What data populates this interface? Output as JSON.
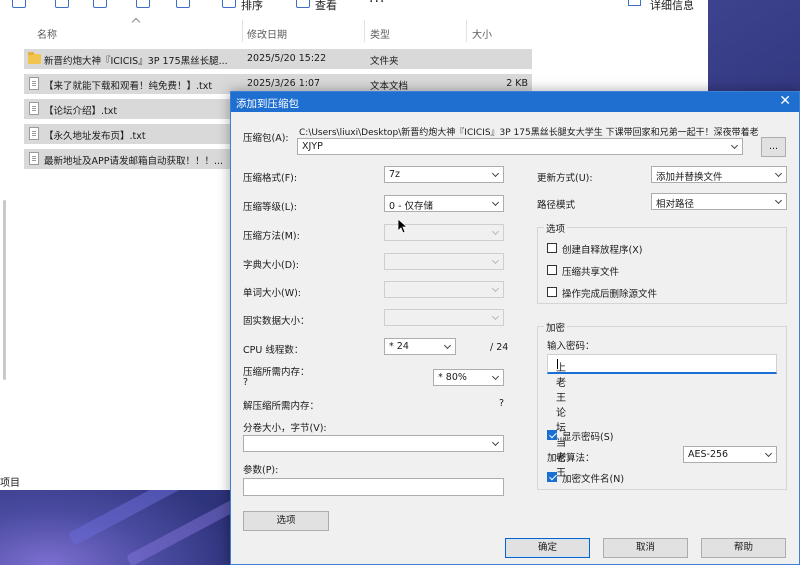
{
  "explorer": {
    "toolbar": {
      "sort_label": "排序",
      "view_label": "查看",
      "more_label": "···",
      "details_label": "详细信息"
    },
    "columns": {
      "name": "名称",
      "modified": "修改日期",
      "type": "类型",
      "size": "大小"
    },
    "rows": [
      {
        "name": "新晋约炮大神『ICICIS』3P 175黑丝长腿...",
        "date": "2025/5/20 15:22",
        "type": "文件夹",
        "size": "",
        "icon": "folder-icon"
      },
      {
        "name": "【来了就能下载和观看！纯免费！】.txt",
        "date": "2025/3/26 1:07",
        "type": "文本文档",
        "size": "2 KB",
        "icon": "text-file-icon"
      },
      {
        "name": "【论坛介绍】.txt",
        "date": "",
        "type": "",
        "size": "",
        "icon": "text-file-icon"
      },
      {
        "name": "【永久地址发布页】.txt",
        "date": "",
        "type": "",
        "size": "",
        "icon": "text-file-icon"
      },
      {
        "name": "最新地址及APP请发邮箱自动获取！！！...",
        "date": "",
        "type": "",
        "size": "",
        "icon": "text-file-icon"
      }
    ],
    "status_text": "项目"
  },
  "dialog": {
    "title": "添加到压缩包",
    "close_glyph": "✕",
    "archive_label": "压缩包(A):",
    "archive_path": "C:\\Users\\liuxi\\Desktop\\新晋约炮大神『ICICIS』3P 175黑丝长腿女大学生 下课带回家和兄弟一起干！深夜带着老",
    "archive_name": "XJYP",
    "browse_label": "...",
    "format_label": "压缩格式(F):",
    "format_value": "7z",
    "level_label": "压缩等级(L):",
    "level_value": "0 - 仅存储",
    "method_label": "压缩方法(M):",
    "dict_label": "字典大小(D):",
    "word_label": "单词大小(W):",
    "solid_label": "固实数据大小：",
    "cpu_label": "CPU 线程数：",
    "cpu_value": "* 24",
    "cpu_total": "/ 24",
    "mem_comp_label": "压缩所需内存：",
    "mem_comp_value": "?",
    "mem_pct": "* 80%",
    "mem_decomp_label": "解压缩所需内存：",
    "mem_decomp_value": "?",
    "split_label": "分卷大小，字节(V):",
    "params_label": "参数(P):",
    "options_button": "选项",
    "update_label": "更新方式(U):",
    "update_value": "添加并替换文件",
    "path_label": "路径模式",
    "path_value": "相对路径",
    "options_group": "选项",
    "opt_sfx": "创建自释放程序(X)",
    "opt_shared": "压缩共享文件",
    "opt_delete": "操作完成后删除源文件",
    "encrypt_group": "加密",
    "pw_label": "输入密码：",
    "pw_value": "上老王论坛当老王",
    "show_pw": "显示密码(S)",
    "algo_label": "加密算法：",
    "algo_value": "AES-256",
    "encrypt_names": "加密文件名(N)",
    "ok": "确定",
    "cancel": "取消",
    "help": "帮助",
    "checked": {
      "sfx": false,
      "shared": false,
      "delete": false,
      "show_pw": true,
      "encrypt_names": true
    }
  },
  "colors": {
    "accent": "#1f6fd1",
    "selected_row": "#d9d9d9",
    "dialog_bg": "#f0f0f0",
    "folder": "#f2c44e"
  }
}
